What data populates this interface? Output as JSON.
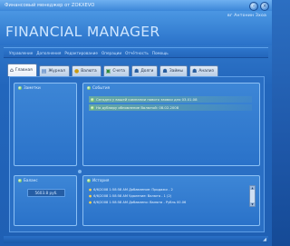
{
  "window": {
    "title": "Финансовый менеджер от ZOKXEVO"
  },
  "header": {
    "user": "вг Антонин Зхоа",
    "app_title": "FINANCIAL MANAGER"
  },
  "menu": {
    "items": [
      "Управление",
      "Дополнения",
      "Редактирование",
      "Операции",
      "Отчётность",
      "Помощь"
    ]
  },
  "tabs": [
    {
      "label": "Главная",
      "icon": "home-icon"
    },
    {
      "label": "Журнал",
      "icon": "journal-icon"
    },
    {
      "label": "Валюта",
      "icon": "currency-icon"
    },
    {
      "label": "Счета",
      "icon": "accounts-icon"
    },
    {
      "label": "Долги",
      "icon": "debts-icon"
    },
    {
      "label": "Займы",
      "icon": "loans-icon"
    },
    {
      "label": "Анализ",
      "icon": "analysis-icon"
    }
  ],
  "panels": {
    "notes_title": "Заметки",
    "events_title": "События",
    "events": [
      "Сегодня у вашей компании нового заявки для 03.01.08",
      "На дублиру обновление Валютой: 08.02.2008"
    ],
    "balance_title": "Баланс",
    "balance_value": "5603.8 руб.",
    "history_title": "История",
    "history": [
      "6/6/2008 1:58:58 AM Добавление: Продажи - 2",
      "6/6/2008 1:58:58 AM Удаление: Валюта - 1 (2)",
      "6/6/2008 1:58:58 AM Добавлено: Валюта - Рубль 00.06"
    ]
  }
}
